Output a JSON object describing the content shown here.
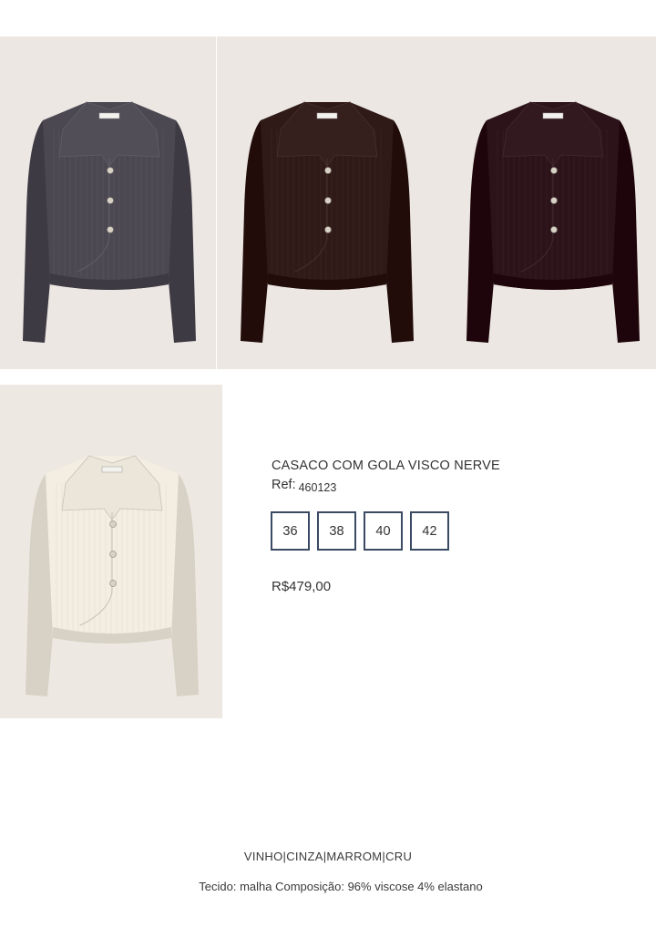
{
  "product": {
    "title": "CASACO COM GOLA VISCO NERVE",
    "ref_label": "Ref:",
    "ref_number": "460123",
    "sizes": [
      "36",
      "38",
      "40",
      "42"
    ],
    "price": "R$479,00"
  },
  "footer": {
    "colors": "VINHO|CINZA|MARROM|CRU",
    "fabric": "Tecido: malha Composição: 96% viscose 4% elastano"
  },
  "images": [
    {
      "name": "jacket-cinza-image",
      "color": "#4b4852"
    },
    {
      "name": "jacket-marrom-image",
      "color": "#2f1a17"
    },
    {
      "name": "jacket-vinho-image",
      "color": "#2c1319"
    },
    {
      "name": "jacket-cru-image",
      "color": "#f3eee1"
    }
  ]
}
